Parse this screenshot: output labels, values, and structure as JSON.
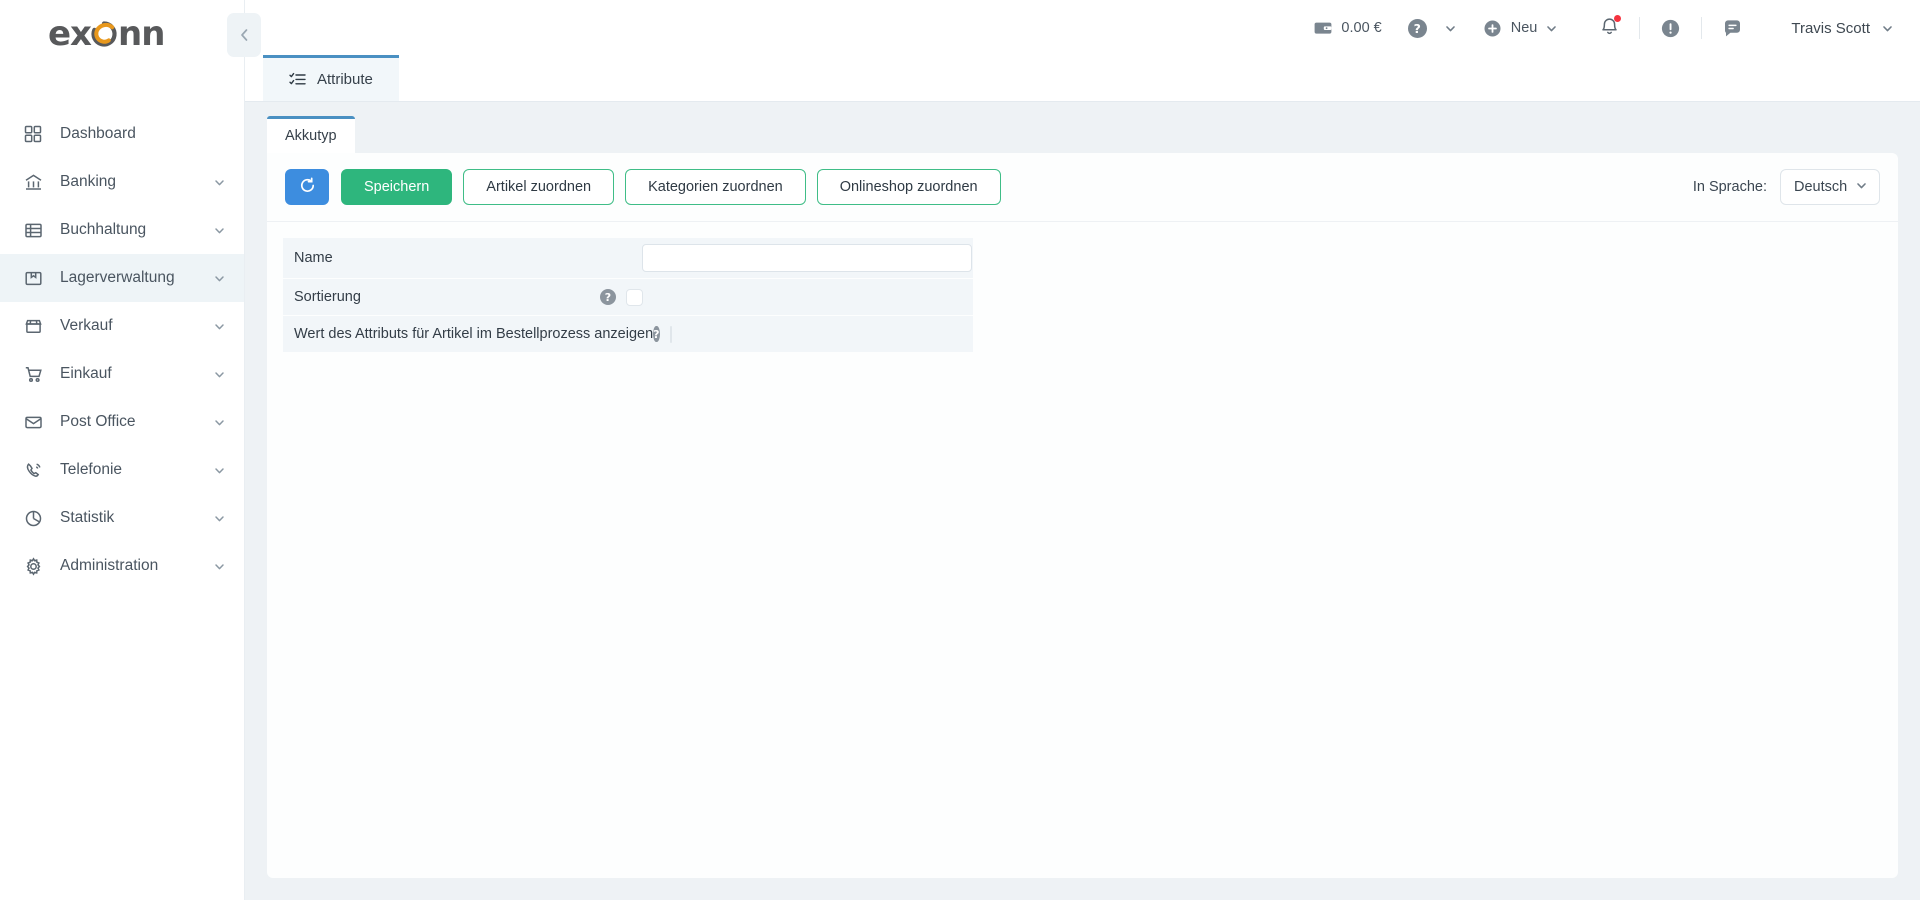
{
  "brand": {
    "name": "exonn",
    "color_gray": "#58595b",
    "color_orange": "#e8981d"
  },
  "sidebar": {
    "collapse_icon": "chevron-left-icon",
    "items": [
      {
        "label": "Dashboard",
        "icon": "grid-icon",
        "expandable": false,
        "active": false
      },
      {
        "label": "Banking",
        "icon": "bank-icon",
        "expandable": true,
        "active": false
      },
      {
        "label": "Buchhaltung",
        "icon": "ledger-icon",
        "expandable": true,
        "active": false
      },
      {
        "label": "Lagerverwaltung",
        "icon": "box-icon",
        "expandable": true,
        "active": true
      },
      {
        "label": "Verkauf",
        "icon": "storefront-icon",
        "expandable": true,
        "active": false
      },
      {
        "label": "Einkauf",
        "icon": "shopping-cart-icon",
        "expandable": true,
        "active": false
      },
      {
        "label": "Post Office",
        "icon": "envelope-icon",
        "expandable": true,
        "active": false
      },
      {
        "label": "Telefonie",
        "icon": "phone-icon",
        "expandable": true,
        "active": false
      },
      {
        "label": "Statistik",
        "icon": "pie-chart-icon",
        "expandable": true,
        "active": false
      },
      {
        "label": "Administration",
        "icon": "gear-icon",
        "expandable": true,
        "active": false
      }
    ]
  },
  "topbar": {
    "balance": "0.00 €",
    "balance_icon": "wallet-icon",
    "help_icon": "question-circle-icon",
    "new_label": "Neu",
    "new_icon": "plus-circle-icon",
    "notification_icon": "bell-icon",
    "notification_dot_color": "#f5333f",
    "alert_icon": "exclamation-circle-icon",
    "message_icon": "chat-bubble-icon",
    "user": "Travis Scott"
  },
  "tabs": {
    "main": {
      "label": "Attribute",
      "icon": "checklist-icon",
      "accent": "#4a90c2"
    },
    "sub": {
      "label": "Akkutyp"
    }
  },
  "toolbar": {
    "refresh_icon": "refresh-icon",
    "refresh_color": "#3d8ddf",
    "save_label": "Speichern",
    "save_color": "#2eb67d",
    "assign_articles_label": "Artikel zuordnen",
    "assign_categories_label": "Kategorien zuordnen",
    "assign_onlineshop_label": "Onlineshop zuordnen",
    "language_label": "In Sprache:",
    "language_value": "Deutsch"
  },
  "form": {
    "rows": [
      {
        "label": "Name",
        "type": "text",
        "value": "",
        "placeholder": "",
        "help": false
      },
      {
        "label": "Sortierung",
        "type": "checkbox",
        "checked": false,
        "help": true,
        "help_glyph": "?"
      },
      {
        "label": "Wert des Attributs für Artikel im Bestellprozess anzeigen",
        "type": "checkbox",
        "checked": false,
        "help": true,
        "help_glyph": "?"
      }
    ]
  }
}
